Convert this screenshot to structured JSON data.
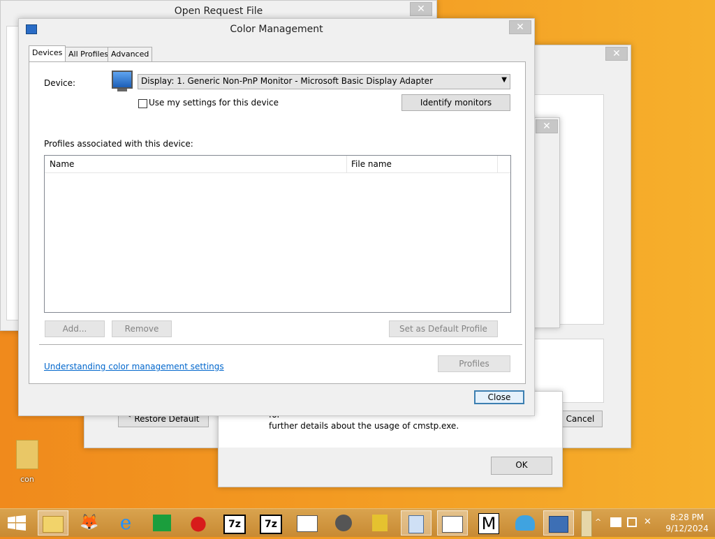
{
  "background_windows": {
    "open_request_file": {
      "title": "Open Request File",
      "close": "✕"
    },
    "back_win": {
      "close": "✕",
      "restore_default": "Restore Default",
      "cancel": "Cancel"
    },
    "small_win": {
      "close": "✕"
    },
    "cmstp_dialog": {
      "text_partial": "for",
      "text": "further details about the usage of cmstp.exe.",
      "ok": "OK"
    }
  },
  "dialog": {
    "title": "Color Management",
    "close": "✕",
    "tabs": [
      "Devices",
      "All Profiles",
      "Advanced"
    ],
    "device_label": "Device:",
    "device_value": "Display: 1. Generic Non-PnP Monitor - Microsoft Basic Display Adapter",
    "use_my_settings": "Use my settings for this device",
    "identify_monitors": "Identify monitors",
    "profiles_label": "Profiles associated with this device:",
    "columns": [
      "Name",
      "File name"
    ],
    "add": "Add...",
    "remove": "Remove",
    "set_default": "Set as Default Profile",
    "link": "Understanding color management settings",
    "profiles": "Profiles",
    "close_button": "Close"
  },
  "desktop": {
    "folder_label": "con"
  },
  "taskbar": {
    "icons": [
      "start-icon",
      "file-explorer-icon",
      "firefox-icon",
      "internet-explorer-icon",
      "store-icon",
      "opera-icon",
      "7zip-icon",
      "7zip-icon-2",
      "window-app-icon",
      "network-app-icon",
      "keys-app-icon",
      "calculator-icon",
      "window-app-icon-2",
      "m-app-icon",
      "seashell-app-icon",
      "network-settings-icon"
    ],
    "labels": {
      "seven_zip": "7z",
      "m_app": "M"
    },
    "overflow": "^",
    "time": "8:28 PM",
    "date": "9/12/2024"
  }
}
